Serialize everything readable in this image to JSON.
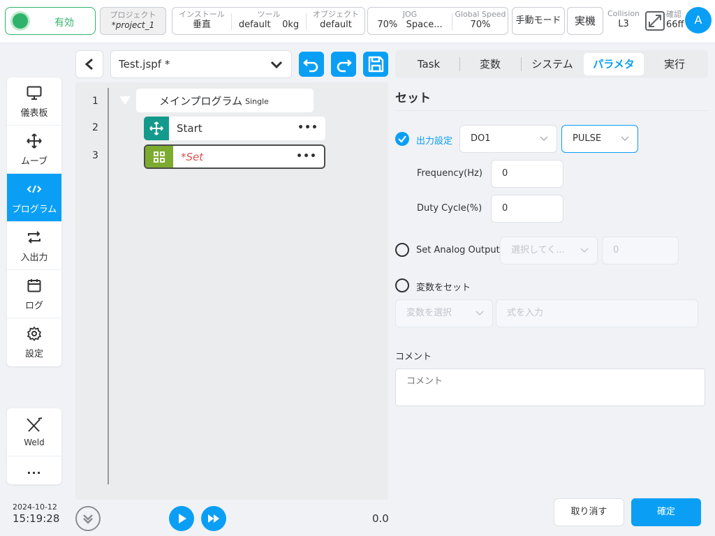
{
  "topbar": {
    "enable_label": "有効",
    "project": {
      "label": "プロジェクト",
      "value": "*project_1"
    },
    "install": {
      "label": "インストール",
      "value": "垂直"
    },
    "tool": {
      "label": "ツール",
      "name": "default",
      "weight": "0kg"
    },
    "object": {
      "label": "オブジェクト",
      "value": "default"
    },
    "jog": {
      "label": "JOG",
      "speed": "70%",
      "space": "Space..."
    },
    "global_speed": {
      "label": "Global Speed",
      "value": "70%"
    },
    "manual_mode": "手動モード",
    "real_machine": "実機",
    "collision": {
      "label": "Collision",
      "value": "L3"
    },
    "confirm": {
      "label": "確認",
      "value": "66ff"
    },
    "avatar": "A"
  },
  "sidebar": {
    "items": [
      {
        "label": "儀表板",
        "icon": "monitor-icon"
      },
      {
        "label": "ムーブ",
        "icon": "move-icon"
      },
      {
        "label": "プログラム",
        "icon": "code-icon"
      },
      {
        "label": "入出力",
        "icon": "io-icon"
      },
      {
        "label": "ログ",
        "icon": "calendar-icon"
      },
      {
        "label": "設定",
        "icon": "gear-icon"
      }
    ],
    "weld_label": "Weld",
    "more_label": "...",
    "date": "2024-10-12",
    "time": "15:19:28"
  },
  "editor": {
    "file_name": "Test.jspf *",
    "line_numbers": [
      "1",
      "2",
      "3"
    ],
    "main_program": "メインプログラム",
    "main_mode": "Single",
    "start_label": "Start",
    "set_label": "*Set",
    "counter": "0.0"
  },
  "tabs": [
    "Task",
    "変数",
    "システム",
    "パラメタ",
    "実行"
  ],
  "params": {
    "section_title": "セット",
    "output_setting_label": "出力設定",
    "output_select": "DO1",
    "mode_select": "PULSE",
    "frequency_label": "Frequency(Hz)",
    "frequency_value": "0",
    "duty_label": "Duty Cycle(%)",
    "duty_value": "0",
    "analog_label": "Set Analog Output",
    "analog_select_placeholder": "選択してく...",
    "analog_value": "0",
    "var_label": "変数をセット",
    "var_select_placeholder": "変数を選択",
    "expr_placeholder": "式を入力",
    "comment_label": "コメント",
    "comment_placeholder": "コメント",
    "cancel_label": "取り消す",
    "ok_label": "確定"
  },
  "colors": {
    "accent": "#0a9ff5",
    "enabled_green": "#2fb36a",
    "start_teal": "#139a8c",
    "set_olive": "#7cab2f",
    "set_text": "#d9534f"
  }
}
